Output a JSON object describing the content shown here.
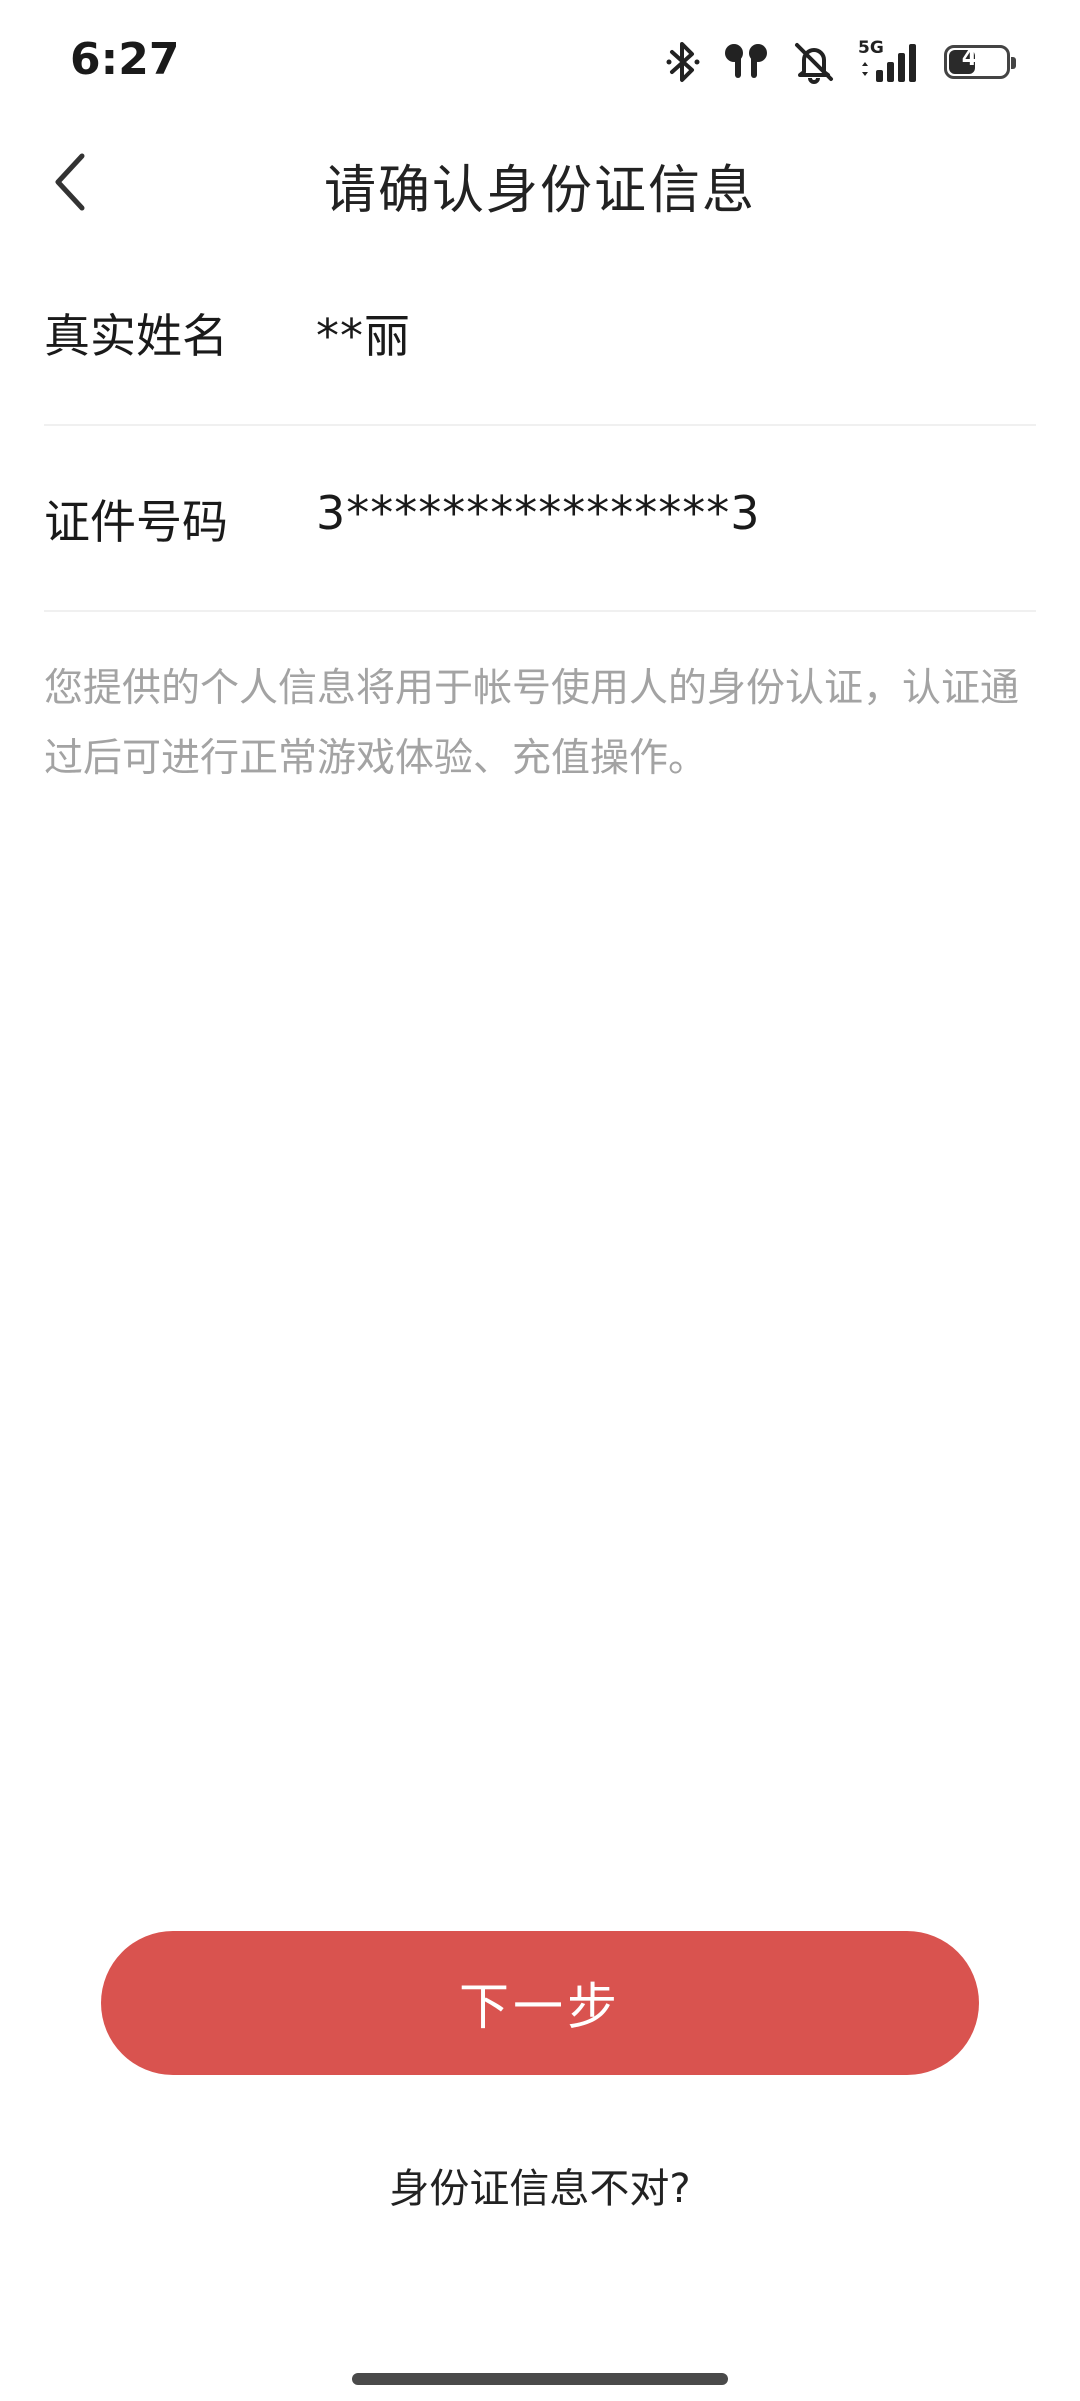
{
  "status_bar": {
    "time": "6:27",
    "icons": [
      "bluetooth-icon",
      "earbuds-icon",
      "mute-icon",
      "signal-5g-icon"
    ],
    "network": "5G",
    "battery_level": "47",
    "battery_fraction": 0.47
  },
  "header": {
    "back_icon": "chevron-left-icon",
    "title": "请确认身份证信息"
  },
  "info": {
    "name_label": "真实姓名",
    "name_value": "**丽",
    "id_label": "证件号码",
    "id_value": "3****************3"
  },
  "notice": "您提供的个人信息将用于帐号使用人的身份认证，认证通过后可进行正常游戏体验、充值操作。",
  "actions": {
    "next_label": "下一步",
    "wrong_info_label": "身份证信息不对?"
  },
  "colors": {
    "primary": "#d9534f",
    "notice_text": "#a3a3a3",
    "divider": "#f0f0f0"
  }
}
